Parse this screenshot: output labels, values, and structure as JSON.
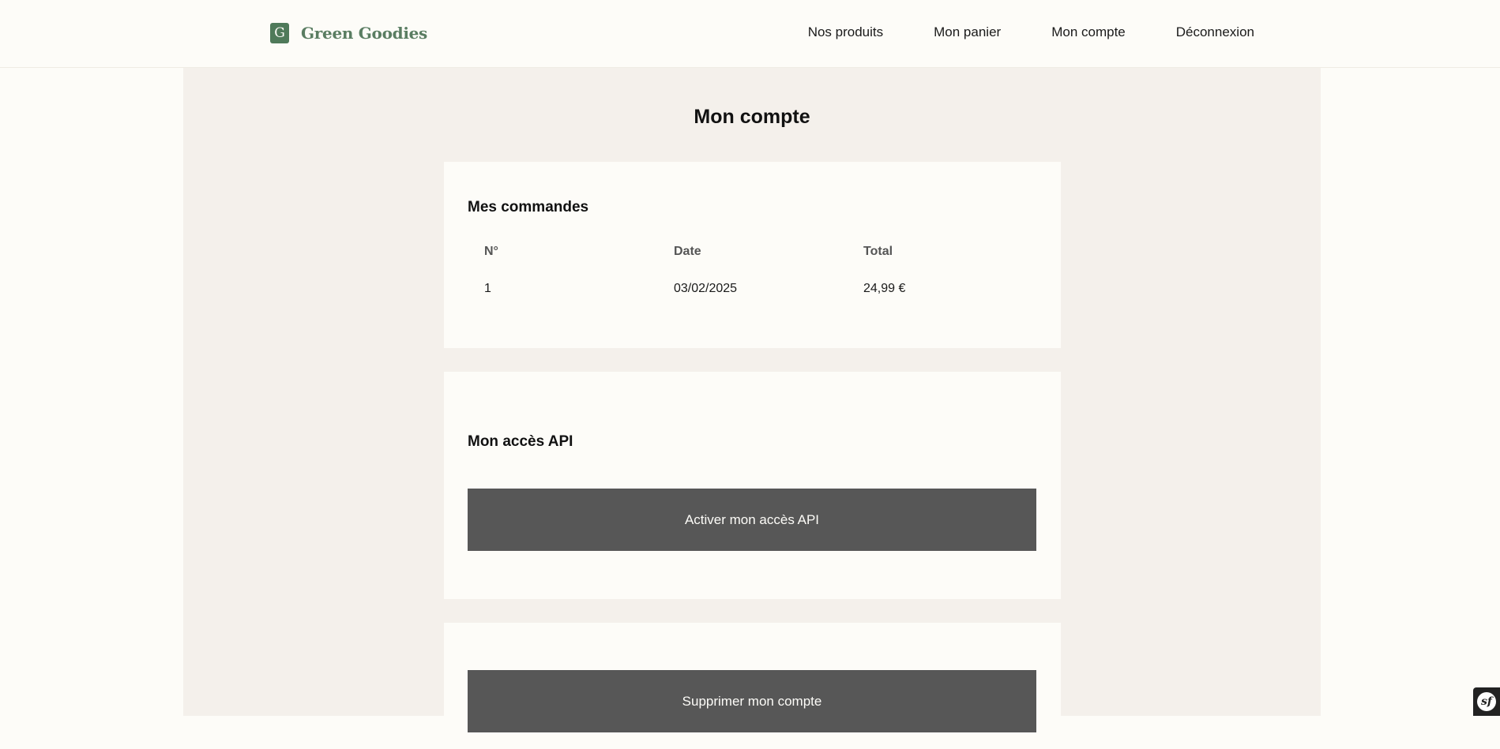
{
  "brand": {
    "logo_letter": "G",
    "name": "Green Goodies",
    "color": "#4f7a5a"
  },
  "nav": {
    "items": [
      {
        "label": "Nos produits"
      },
      {
        "label": "Mon panier"
      },
      {
        "label": "Mon compte"
      },
      {
        "label": "Déconnexion"
      }
    ]
  },
  "page": {
    "title": "Mon compte"
  },
  "orders": {
    "title": "Mes commandes",
    "columns": [
      "N°",
      "Date",
      "Total"
    ],
    "rows": [
      {
        "number": "1",
        "date": "03/02/2025",
        "total": "24,99 €"
      }
    ]
  },
  "api": {
    "title": "Mon accès API",
    "button_label": "Activer mon accès API"
  },
  "account": {
    "delete_label": "Supprimer mon compte"
  },
  "debug_toolbar": {
    "icon": "symfony-icon",
    "glyph": "sf"
  },
  "colors": {
    "background": "#fdfcf8",
    "main_panel": "#f4f0eb",
    "button": "#575757"
  }
}
